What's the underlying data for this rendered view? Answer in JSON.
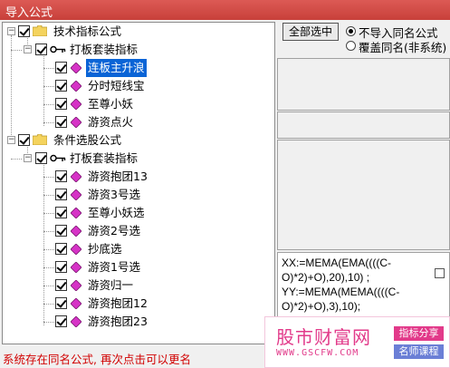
{
  "window": {
    "title": "导入公式"
  },
  "tree": {
    "groups": [
      {
        "label": "技术指标公式",
        "subgroups": [
          {
            "label": "打板套装指标",
            "items": [
              "连板主升浪",
              "分时短线宝",
              "至尊小妖",
              "游资点火"
            ]
          }
        ]
      },
      {
        "label": "条件选股公式",
        "subgroups": [
          {
            "label": "打板套装指标",
            "items": [
              "游资抱团13",
              "游资3号选",
              "至尊小妖选",
              "游资2号选",
              "抄底选",
              "游资1号选",
              "游资归一",
              "游资抱团12",
              "游资抱团23"
            ]
          }
        ]
      }
    ],
    "selected_item": "连板主升浪"
  },
  "controls": {
    "select_all_label": "全部选中",
    "option_no_import": "不导入同名公式",
    "option_overwrite": "覆盖同名(非系统)",
    "selected_option": "不导入同名公式"
  },
  "code": {
    "lines": [
      "XX:=MEMA(EMA((((C-",
      "O)*2)+O),20),10) ;",
      "YY:=MEMA(MEMA((((C-",
      "O)*2)+O),3),10);"
    ]
  },
  "status": {
    "message": "系统存在同名公式, 再次点击可以更名"
  },
  "watermark": {
    "brand": "股市财富网",
    "url": "WWW.GSCFW.COM",
    "tag1": "指标分享",
    "tag2": "名师课程"
  },
  "colors": {
    "title_bar": "#d04640",
    "selection": "#0a64d6",
    "status_text": "#d10000",
    "watermark": "#e23a8a",
    "tag1": "#e23a8a",
    "tag2": "#6b7fd6"
  }
}
